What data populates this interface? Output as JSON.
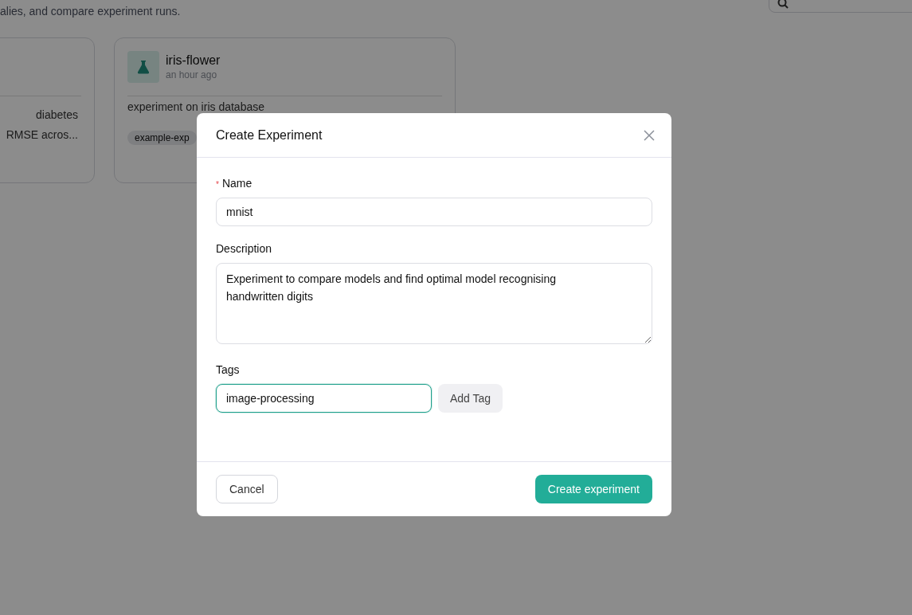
{
  "page": {
    "subtitle": "alies, and compare experiment runs."
  },
  "cards": [
    {
      "kind": "cut",
      "description_lines": [
        "diabetes",
        "RMSE acros..."
      ]
    },
    {
      "kind": "full",
      "name": "iris-flower",
      "time": "an hour ago",
      "description": "experiment on iris database",
      "tags": [
        "example-exp"
      ]
    }
  ],
  "dialog": {
    "title": "Create Experiment",
    "fields": [
      {
        "kind": "input",
        "label": "Name",
        "required_mark": "*",
        "value": "mnist"
      },
      {
        "kind": "textarea",
        "label": "Description",
        "value": "Experiment to compare models and find optimal model recognising handwritten digits"
      },
      {
        "kind": "tag",
        "label": "Tags",
        "value": "image-processing",
        "focused": true,
        "button": "Add Tag"
      }
    ],
    "cancel": "Cancel",
    "submit": "Create experiment"
  }
}
